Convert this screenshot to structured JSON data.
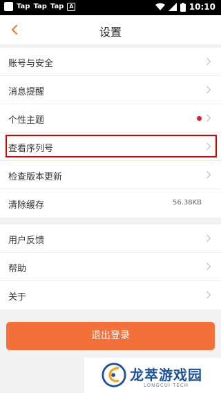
{
  "status_bar": {
    "apps": [
      "Tap",
      "Tap",
      "Tap"
    ],
    "a_icon": "A",
    "time": "10:10"
  },
  "header": {
    "title": "设置"
  },
  "group1": [
    {
      "label": "账号与安全"
    },
    {
      "label": "消息提醒"
    },
    {
      "label": "个性主题"
    },
    {
      "label": "查看序列号"
    },
    {
      "label": "检查版本更新"
    },
    {
      "label": "清除缓存",
      "value": "56.38KB"
    }
  ],
  "group2": [
    {
      "label": "用户反馈"
    },
    {
      "label": "帮助"
    },
    {
      "label": "关于"
    }
  ],
  "logout": {
    "label": "退出登录"
  },
  "watermark": {
    "brand_cn": "龙萃游戏园",
    "brand_en": "LONGCUI TECH"
  },
  "colors": {
    "accent": "#f4703a",
    "back_arrow": "#f08030",
    "badge": "#e8192c",
    "highlight_box": "#e00000"
  }
}
